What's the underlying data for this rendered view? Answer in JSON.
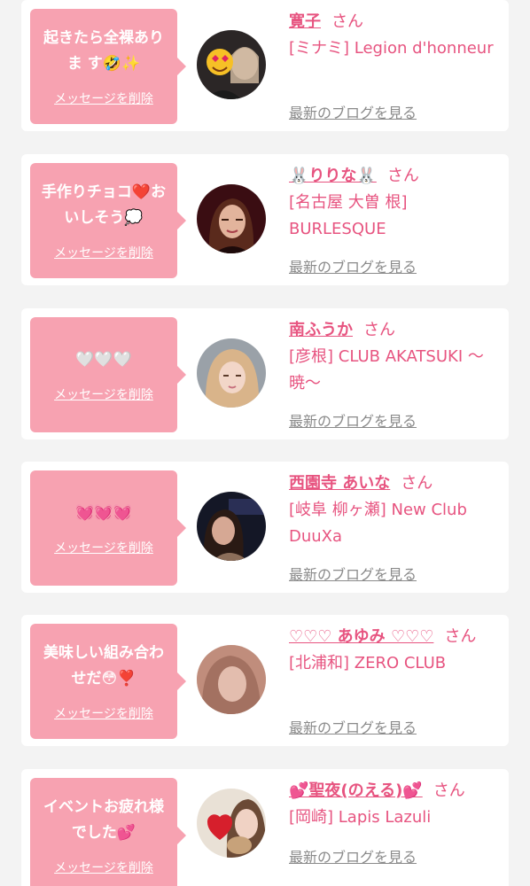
{
  "delete_label": "メッセージを削除",
  "san_label": "さん",
  "blog_label": "最新のブログを見る",
  "colors": {
    "bubble": "#f7a2b1",
    "accent": "#e75480",
    "link_gray": "#8a8a8a"
  },
  "cards": [
    {
      "message": "起きたら全裸ありま す🤣✨",
      "name": "寛子",
      "shop": "[ミナミ] Legion d'honneur",
      "avatar": "photo-two-women-emoji"
    },
    {
      "message": "手作りチョコ❤️お いしそう💭",
      "name": "🐰りりな🐰",
      "shop": "[名古屋 大曽 根] BURLESQUE",
      "avatar": "photo-woman-red"
    },
    {
      "message": "🤍🤍🤍",
      "name": "南ふうか",
      "shop": "[彦根] CLUB AKATSUKI 〜暁〜",
      "avatar": "photo-woman-blonde"
    },
    {
      "message": "💓💓💓",
      "name": "西園寺 あいな",
      "shop": "[岐阜 柳ヶ瀬] New Club DuuXa",
      "avatar": "photo-woman-dark"
    },
    {
      "message": "美味しい組み合わ せだ😳❣️",
      "name": "♡♡♡ あゆみ ♡♡♡",
      "shop": "[北浦和] ZERO CLUB",
      "avatar": "photo-woman-blur"
    },
    {
      "message": "イベントお疲れ様 でした💕",
      "name": "💕聖夜(のえる)💕",
      "shop": "[岡崎] Lapis Lazuli",
      "avatar": "photo-woman-heart"
    }
  ]
}
